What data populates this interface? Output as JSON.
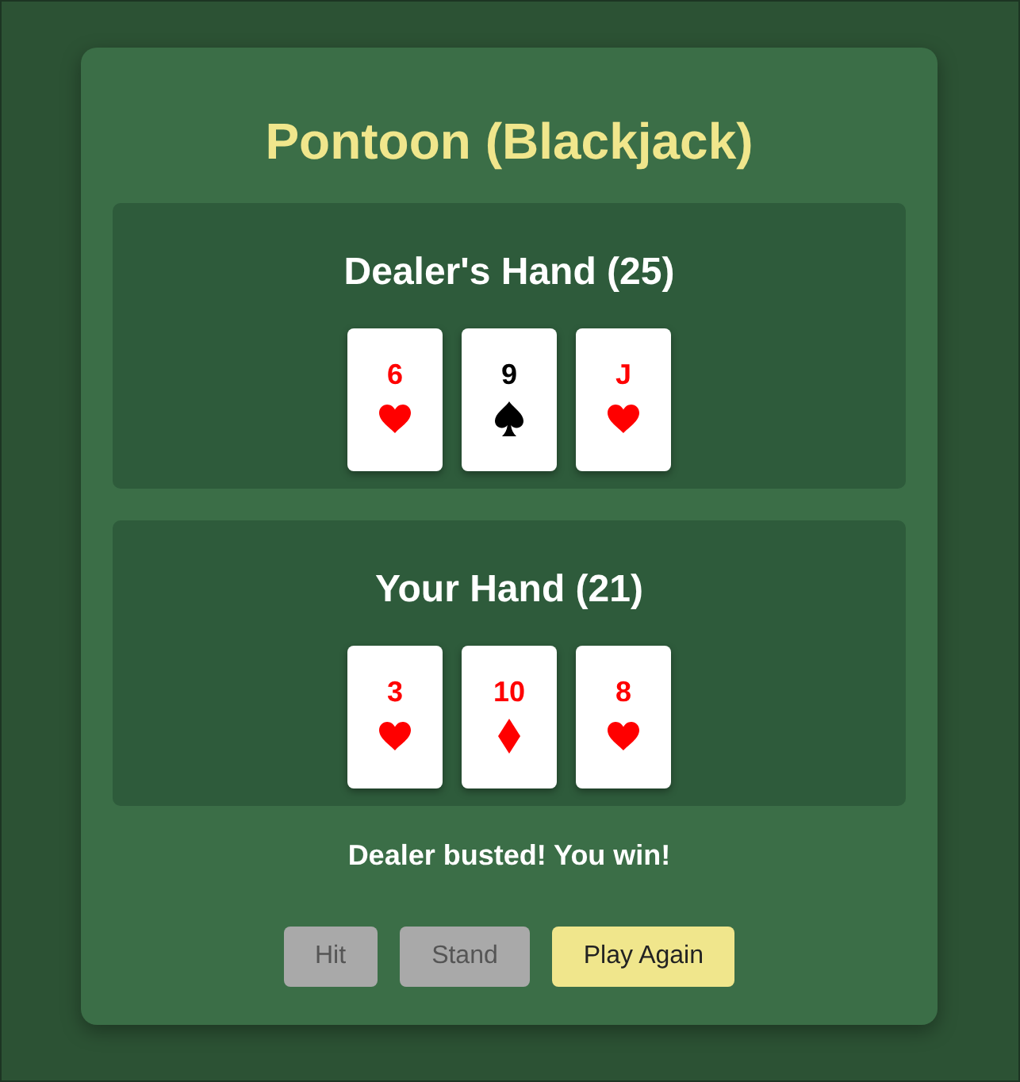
{
  "title": "Pontoon (Blackjack)",
  "hands": [
    {
      "heading": "Dealer's Hand (25)",
      "cards": [
        {
          "rank": "6",
          "kind": "heart",
          "color": "#ff0000"
        },
        {
          "rank": "9",
          "kind": "spade",
          "color": "#000000"
        },
        {
          "rank": "J",
          "kind": "heart",
          "color": "#ff0000"
        }
      ]
    },
    {
      "heading": "Your Hand (21)",
      "cards": [
        {
          "rank": "3",
          "kind": "heart",
          "color": "#ff0000"
        },
        {
          "rank": "10",
          "kind": "diamond",
          "color": "#ff0000"
        },
        {
          "rank": "8",
          "kind": "heart",
          "color": "#ff0000"
        }
      ]
    }
  ],
  "message": "Dealer busted! You win!",
  "buttons": [
    {
      "label": "Hit",
      "disabled": true
    },
    {
      "label": "Stand",
      "disabled": true
    },
    {
      "label": "Play Again",
      "disabled": false
    }
  ]
}
